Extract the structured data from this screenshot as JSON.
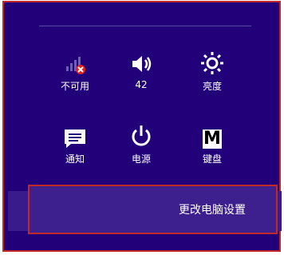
{
  "quick_settings": {
    "network": {
      "label": "不可用",
      "icon": "network-unavailable-icon"
    },
    "volume": {
      "label": "42",
      "icon": "speaker-icon"
    },
    "brightness": {
      "label": "亮度",
      "icon": "sun-icon"
    },
    "notifications": {
      "label": "通知",
      "icon": "message-icon"
    },
    "power": {
      "label": "电源",
      "icon": "power-icon"
    },
    "keyboard": {
      "label": "键盘",
      "icon": "keyboard-layout-icon",
      "glyph": "M"
    }
  },
  "change_pc_settings": "更改电脑设置",
  "colors": {
    "background": "#21007a",
    "highlight_border": "#c0282a",
    "band": "#3a1b8b"
  }
}
